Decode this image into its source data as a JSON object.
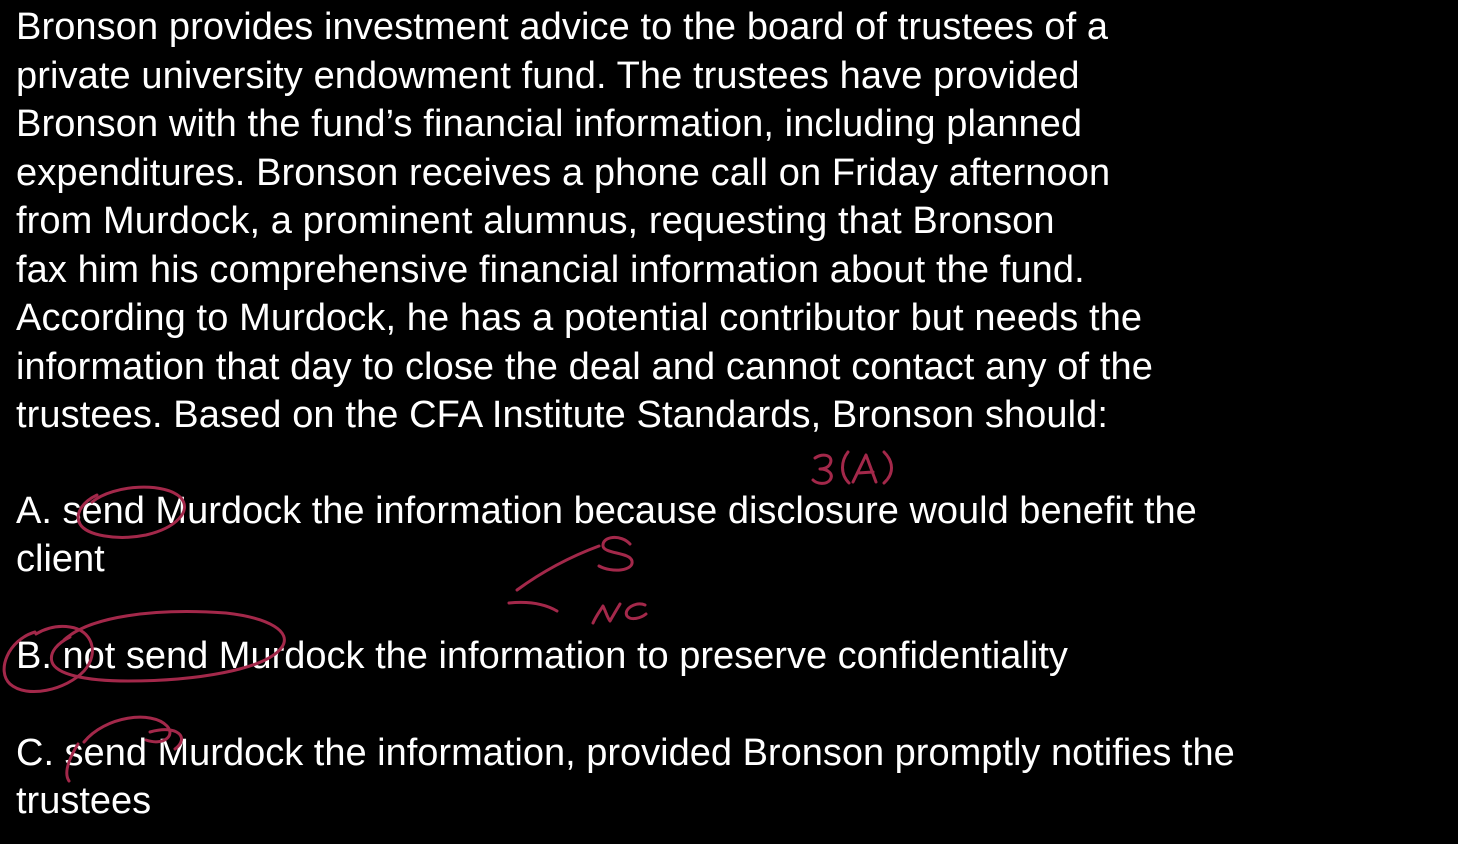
{
  "question": {
    "lines": [
      "Bronson provides investment advice to the board of trustees of a",
      "private university endowment fund.  The trustees have provided",
      "Bronson with the fund’s financial information, including planned",
      "expenditures.  Bronson receives a phone call on Friday afternoon",
      "from Murdock, a prominent alumnus, requesting that Bronson",
      "fax him his comprehensive financial information about the fund.",
      "According to Murdock, he has a potential contributor but needs the",
      "information that day to close the deal and cannot contact any of the",
      "trustees.  Based on the CFA Institute Standards, Bronson should:"
    ]
  },
  "options": {
    "a": {
      "line1": "A.  send Murdock the information because disclosure would benefit the",
      "line2": "client"
    },
    "b": {
      "line1": "B.  not send Murdock the information to preserve confidentiality"
    },
    "c": {
      "line1": "C.  send Murdock the information, provided Bronson promptly notifies the",
      "line2": "trustees"
    }
  },
  "annotations": {
    "standard_ref": "3(A)",
    "mark_s": "S",
    "mark_nc": "NC",
    "ink_color": "#a3284a"
  }
}
